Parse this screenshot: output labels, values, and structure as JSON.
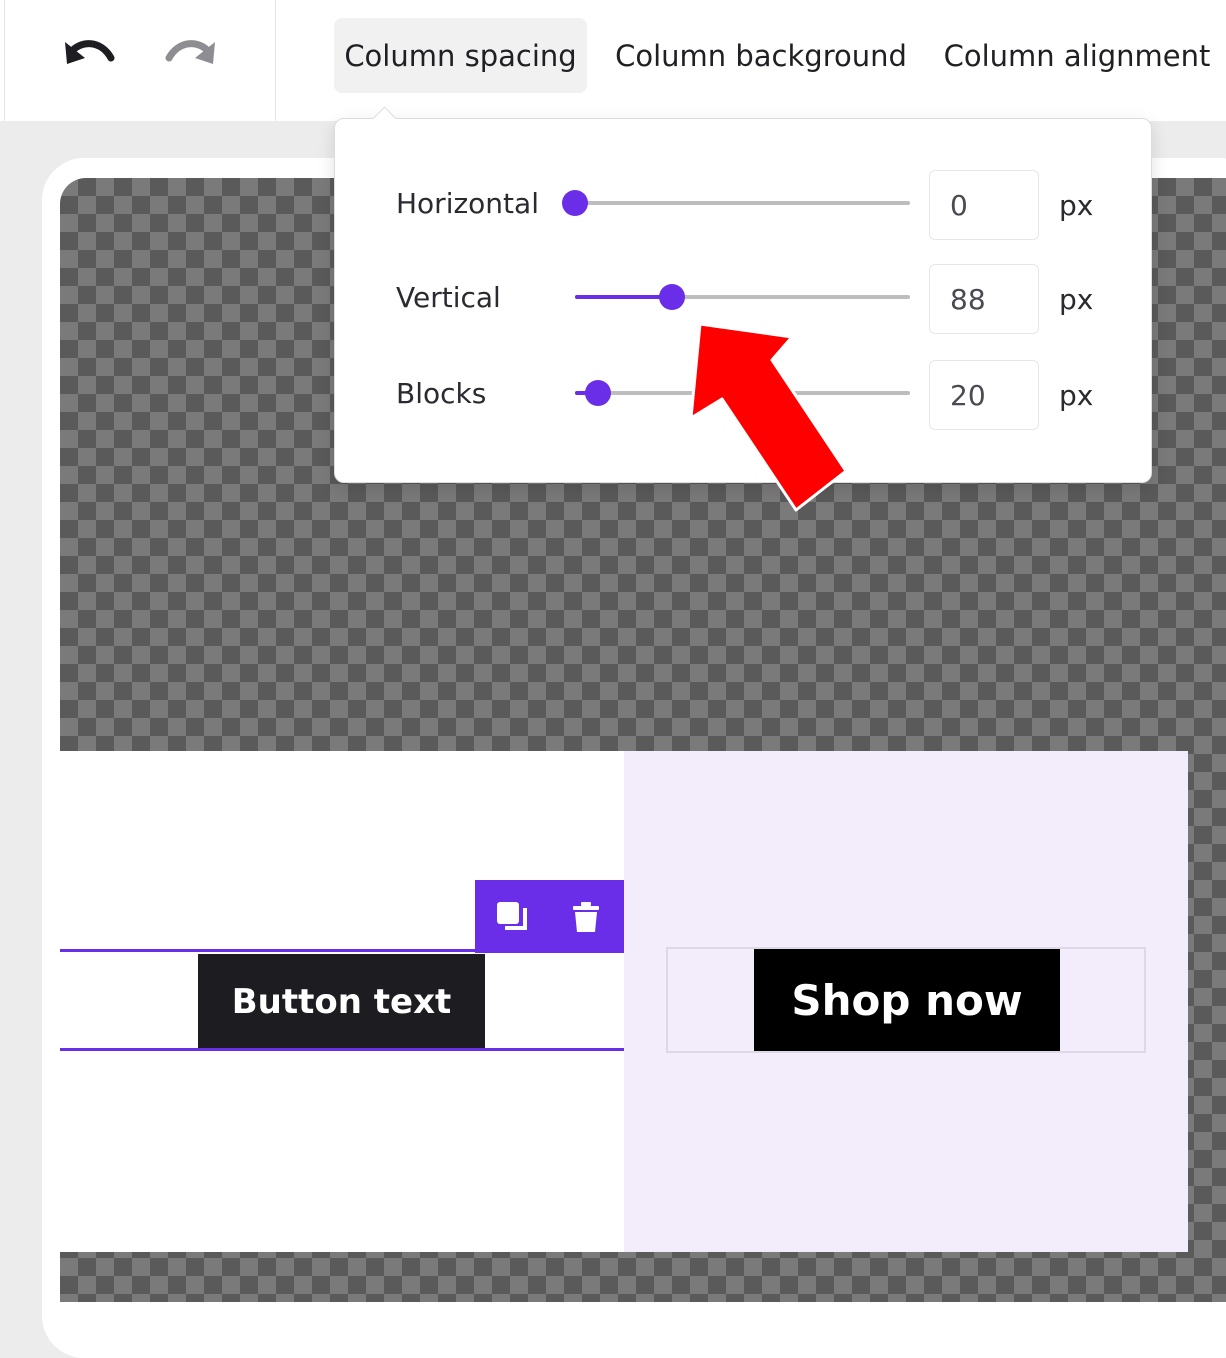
{
  "toolbar": {
    "undo_icon": "undo-icon",
    "redo_icon": "redo-icon",
    "tabs": [
      {
        "label": "Column spacing",
        "active": true
      },
      {
        "label": "Column background",
        "active": false
      },
      {
        "label": "Column alignment",
        "active": false
      }
    ]
  },
  "spacing_popover": {
    "sliders": [
      {
        "label": "Horizontal",
        "value": "0",
        "unit": "px",
        "fraction": 0.0
      },
      {
        "label": "Vertical",
        "value": "88",
        "unit": "px",
        "fraction": 0.29
      },
      {
        "label": "Blocks",
        "value": "20",
        "unit": "px",
        "fraction": 0.07
      }
    ]
  },
  "canvas": {
    "left_button": {
      "label": "Button text"
    },
    "right_button": {
      "label": "Shop now"
    },
    "block_toolbar": {
      "duplicate_icon": "duplicate-icon",
      "delete_icon": "trash-icon"
    }
  },
  "colors": {
    "accent": "#6a2ee8",
    "right_column_bg": "#f3ecfa",
    "annotation_arrow": "#ff0000"
  }
}
